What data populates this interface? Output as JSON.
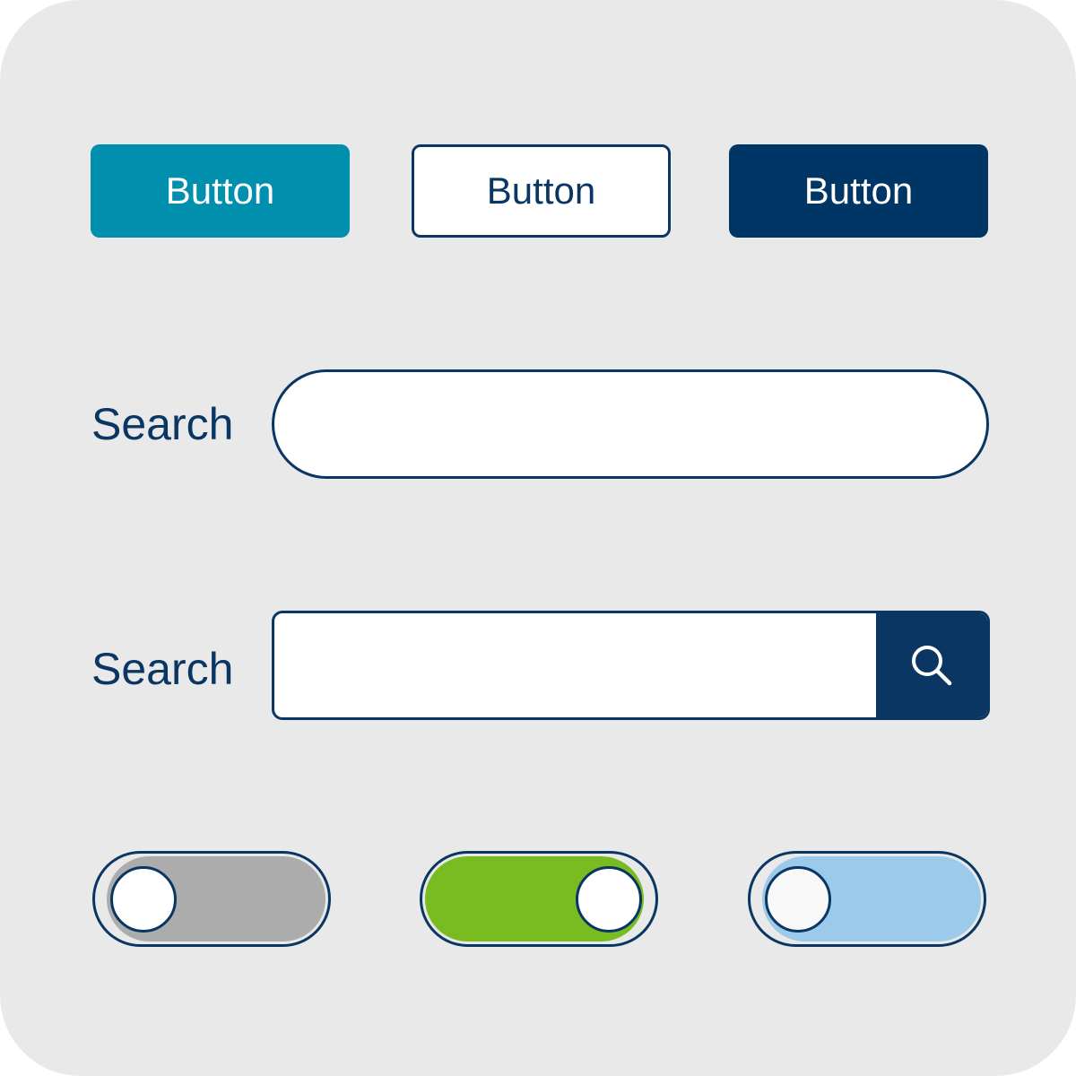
{
  "buttons": [
    {
      "label": "Button",
      "style": "teal-filled",
      "bg": "#008fad",
      "text_color": "#ffffff"
    },
    {
      "label": "Button",
      "style": "outline",
      "bg": "#ffffff",
      "text_color": "#0a3663"
    },
    {
      "label": "Button",
      "style": "navy-filled",
      "bg": "#003665",
      "text_color": "#ffffff"
    }
  ],
  "search_fields": [
    {
      "label": "Search",
      "value": "",
      "placeholder": "",
      "shape": "pill"
    },
    {
      "label": "Search",
      "value": "",
      "placeholder": "",
      "shape": "rect-with-button",
      "button_icon": "magnifier-icon"
    }
  ],
  "toggles": [
    {
      "state": "off",
      "track_color": "#acacac",
      "knob_color": "#ffffff"
    },
    {
      "state": "on",
      "track_color": "#78bc22",
      "knob_color": "#ffffff"
    },
    {
      "state": "off",
      "track_color": "#9ccaea",
      "knob_color": "#f8f8f8"
    }
  ],
  "colors": {
    "background": "#e9e9e9",
    "navy": "#0a3663",
    "teal": "#008fad",
    "green": "#78bc22",
    "light_blue": "#9ccaea",
    "gray": "#acacac"
  }
}
